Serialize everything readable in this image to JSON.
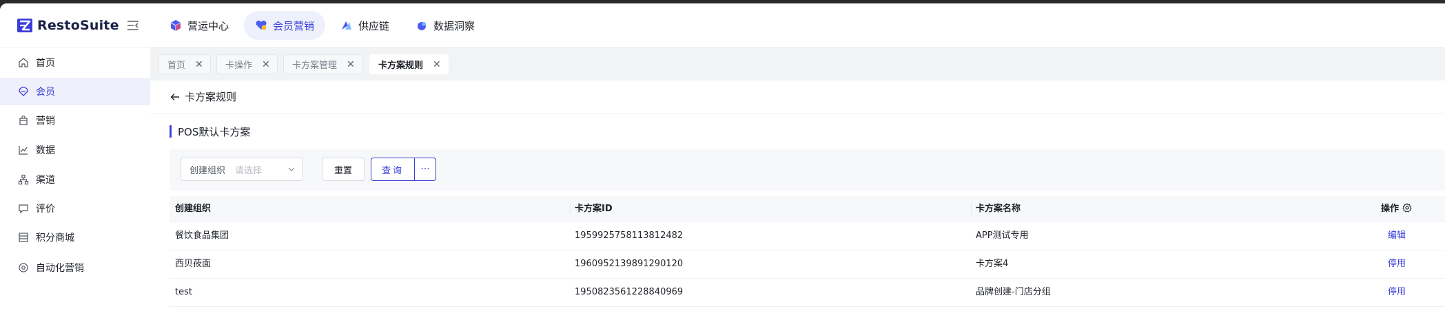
{
  "app": {
    "name": "RestoSuite"
  },
  "topnav": [
    {
      "label": "营运中心",
      "icon": "cube-icon"
    },
    {
      "label": "会员营销",
      "icon": "member-marketing-icon",
      "active": true
    },
    {
      "label": "供应链",
      "icon": "supply-chain-icon"
    },
    {
      "label": "数据洞察",
      "icon": "data-insight-icon"
    }
  ],
  "sidebar": {
    "items": [
      {
        "label": "首页",
        "icon": "home-icon"
      },
      {
        "label": "会员",
        "icon": "member-icon",
        "active": true
      },
      {
        "label": "营销",
        "icon": "shopping-bag-icon"
      },
      {
        "label": "数据",
        "icon": "line-chart-icon"
      },
      {
        "label": "渠道",
        "icon": "channel-icon"
      },
      {
        "label": "评价",
        "icon": "comment-icon"
      },
      {
        "label": "积分商城",
        "icon": "store-icon"
      },
      {
        "label": "自动化营销",
        "icon": "automation-icon"
      }
    ]
  },
  "tabs": [
    {
      "label": "首页"
    },
    {
      "label": "卡操作"
    },
    {
      "label": "卡方案管理"
    },
    {
      "label": "卡方案规则",
      "active": true
    }
  ],
  "page": {
    "title": "卡方案规则",
    "section_title": "POS默认卡方案"
  },
  "filter": {
    "org_label": "创建组织",
    "org_placeholder": "请选择",
    "reset_label": "重置",
    "query_label": "查询",
    "more_label": "···"
  },
  "table": {
    "columns": [
      "创建组织",
      "卡方案ID",
      "卡方案名称",
      "操作"
    ],
    "rows": [
      {
        "org": "餐饮食品集团",
        "id": "1959925758113812482",
        "name": "APP测试专用",
        "action": "编辑"
      },
      {
        "org": "西贝莜面",
        "id": "1960952139891290120",
        "name": "卡方案4",
        "action": "停用"
      },
      {
        "org": "test",
        "id": "1950823561228840969",
        "name": "品牌创建-门店分组",
        "action": "停用"
      }
    ]
  },
  "colors": {
    "accent": "#3b3fd8",
    "active_bg": "#eef0fb",
    "content_bg": "#f2f3f5"
  }
}
